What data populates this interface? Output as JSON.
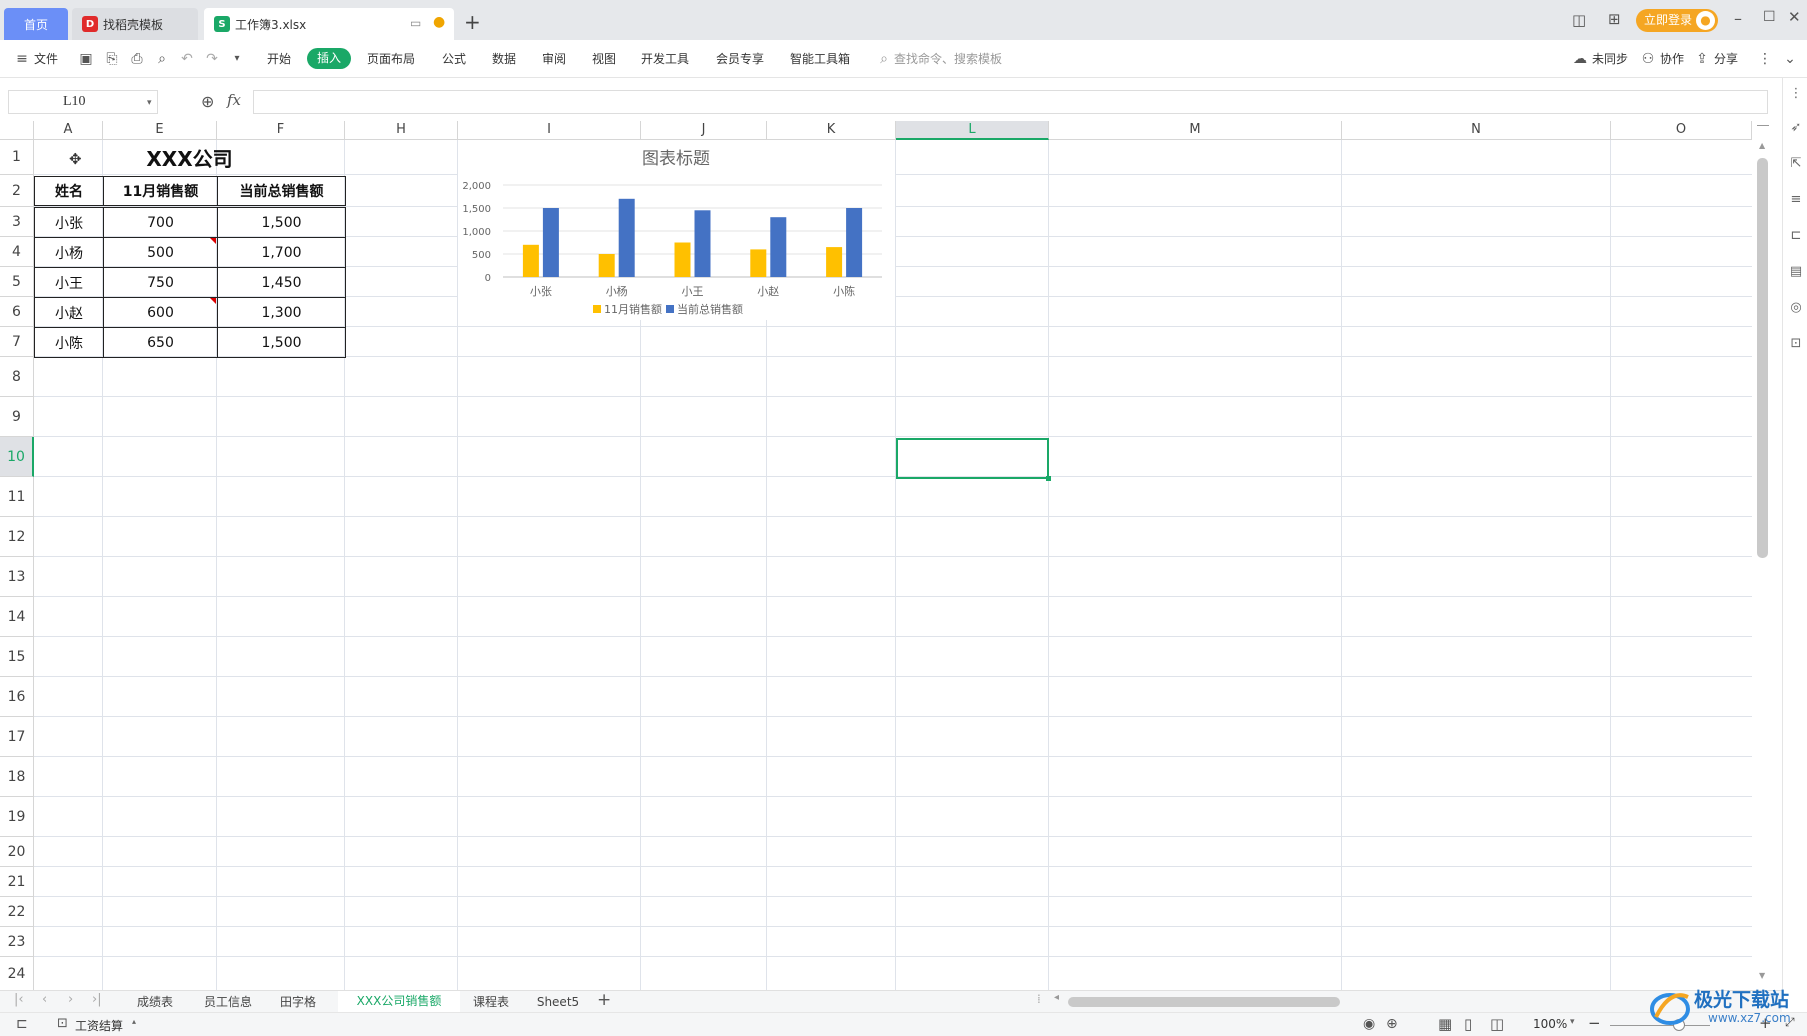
{
  "tabs": {
    "home": "首页",
    "docer": "找稻壳模板",
    "workbook": "工作簿3.xlsx"
  },
  "titlebar": {
    "login": "立即登录"
  },
  "menu": {
    "file": "文件",
    "items": [
      "开始",
      "插入",
      "页面布局",
      "公式",
      "数据",
      "审阅",
      "视图",
      "开发工具",
      "会员专享",
      "智能工具箱"
    ],
    "active": "插入",
    "search": "查找命令、搜索模板",
    "sync": "未同步",
    "collab": "协作",
    "share": "分享"
  },
  "formula": {
    "name_box": "L10",
    "fx": "fx",
    "content": ""
  },
  "columns": [
    "A",
    "E",
    "F",
    "H",
    "I",
    "J",
    "K",
    "L",
    "M",
    "N",
    "O"
  ],
  "rows": [
    "1",
    "2",
    "3",
    "4",
    "5",
    "6",
    "7",
    "8",
    "9",
    "10",
    "11",
    "12",
    "13",
    "14",
    "15",
    "16",
    "17",
    "18",
    "19",
    "20",
    "21",
    "22",
    "23",
    "24"
  ],
  "table": {
    "title": "XXX公司",
    "headers": [
      "姓名",
      "11月销售额",
      "当前总销售额"
    ],
    "rows": [
      [
        "小张",
        "700",
        "1,500"
      ],
      [
        "小杨",
        "500",
        "1,700"
      ],
      [
        "小王",
        "750",
        "1,450"
      ],
      [
        "小赵",
        "600",
        "1,300"
      ],
      [
        "小陈",
        "650",
        "1,500"
      ]
    ]
  },
  "chart_data": {
    "type": "bar",
    "title": "图表标题",
    "categories": [
      "小张",
      "小杨",
      "小王",
      "小赵",
      "小陈"
    ],
    "series": [
      {
        "name": "11月销售额",
        "values": [
          700,
          500,
          750,
          600,
          650
        ],
        "color": "#FFC000"
      },
      {
        "name": "当前总销售额",
        "values": [
          1500,
          1700,
          1450,
          1300,
          1500
        ],
        "color": "#4472C4"
      }
    ],
    "yticks": [
      "0",
      "500",
      "1,000",
      "1,500",
      "2,000"
    ],
    "ylim": [
      0,
      2000
    ],
    "grid": true,
    "legend": "bottom"
  },
  "sheets": {
    "list": [
      "成绩表",
      "员工信息",
      "田字格",
      "XXX公司销售额",
      "课程表",
      "Sheet5"
    ],
    "active": "XXX公司销售额"
  },
  "status": {
    "macro": "工资结算",
    "zoom": "100%"
  },
  "watermark": "极光下载站",
  "watermark_url": "www.xz7.com"
}
